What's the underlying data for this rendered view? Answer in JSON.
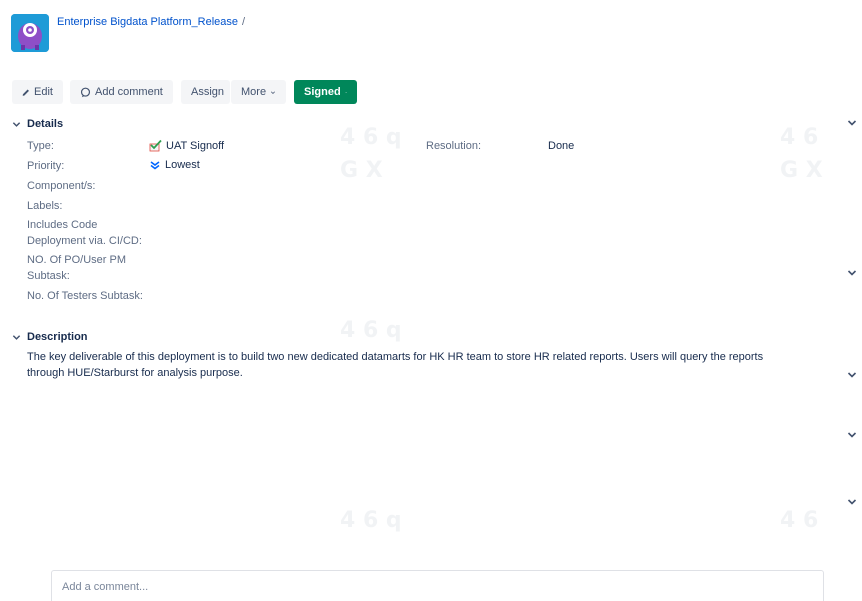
{
  "breadcrumb": {
    "project": "Enterprise Bigdata Platform_Release",
    "separator": "/"
  },
  "toolbar": {
    "edit": "Edit",
    "add_comment": "Add comment",
    "assign": "Assign",
    "more": "More",
    "status": "Signed"
  },
  "details": {
    "heading": "Details",
    "fields": {
      "type_label": "Type:",
      "type_value": "UAT Signoff",
      "priority_label": "Priority:",
      "priority_value": "Lowest",
      "components_label": "Component/s:",
      "labels_label": "Labels:",
      "code_deploy_label_1": "Includes Code",
      "code_deploy_label_2": "Deployment via. CI/CD:",
      "po_subtask_label_1": "NO. Of PO/User PM",
      "po_subtask_label_2": "Subtask:",
      "testers_label": "No. Of Testers Subtask:",
      "resolution_label": "Resolution:",
      "resolution_value": "Done"
    }
  },
  "description": {
    "heading": "Description",
    "text": "The key deliverable of this deployment is to build two new dedicated datamarts for HK HR team to store HR related reports. Users will query the reports through HUE/Starburst for analysis purpose."
  },
  "comment": {
    "placeholder": "Add a comment..."
  },
  "colors": {
    "link": "#0052cc",
    "status_green": "#00875a",
    "avatar_bg": "#1e9bd7"
  },
  "icons": [
    "pencil-icon",
    "speech-bubble-icon",
    "chevron-down-icon",
    "uat-signoff-icon",
    "lowest-priority-icon",
    "project-avatar-icon"
  ]
}
